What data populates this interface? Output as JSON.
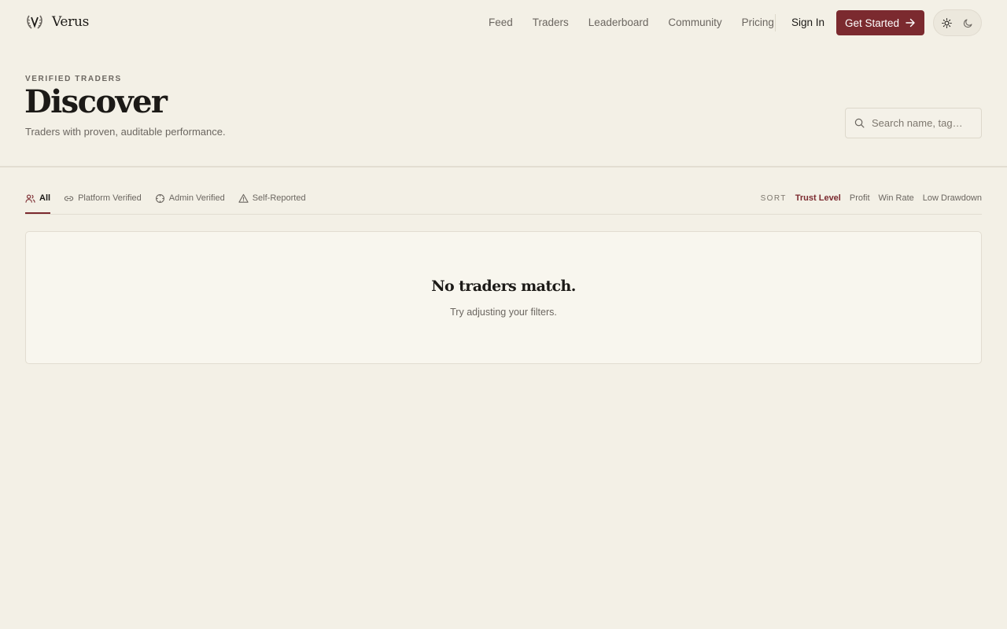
{
  "brand": {
    "name": "Verus",
    "logo_icon": "laurel-v-icon"
  },
  "nav": {
    "items": [
      "Feed",
      "Traders",
      "Leaderboard",
      "Community",
      "Pricing"
    ],
    "sign_in": "Sign In",
    "cta": "Get Started"
  },
  "theme_toggle": {
    "light_icon": "sun-icon",
    "dark_icon": "moon-icon"
  },
  "hero": {
    "eyebrow": "VERIFIED TRADERS",
    "title": "Discover",
    "subtitle": "Traders with proven, auditable performance."
  },
  "search": {
    "placeholder": "Search name, tag…",
    "value": ""
  },
  "filters": {
    "items": [
      {
        "label": "All",
        "icon": "users-icon",
        "active": true
      },
      {
        "label": "Platform Verified",
        "icon": "link-icon",
        "active": false
      },
      {
        "label": "Admin Verified",
        "icon": "crosshair-icon",
        "active": false
      },
      {
        "label": "Self-Reported",
        "icon": "warning-icon",
        "active": false
      }
    ]
  },
  "sort": {
    "label": "SORT",
    "options": [
      "Trust Level",
      "Profit",
      "Win Rate",
      "Low Drawdown"
    ],
    "selected": "Trust Level"
  },
  "empty_state": {
    "title": "No traders match.",
    "subtitle": "Try adjusting your filters."
  },
  "colors": {
    "background": "#f3f0e6",
    "accent": "#7b2a2f",
    "text": "#1c1a17",
    "muted": "#6b6660"
  }
}
